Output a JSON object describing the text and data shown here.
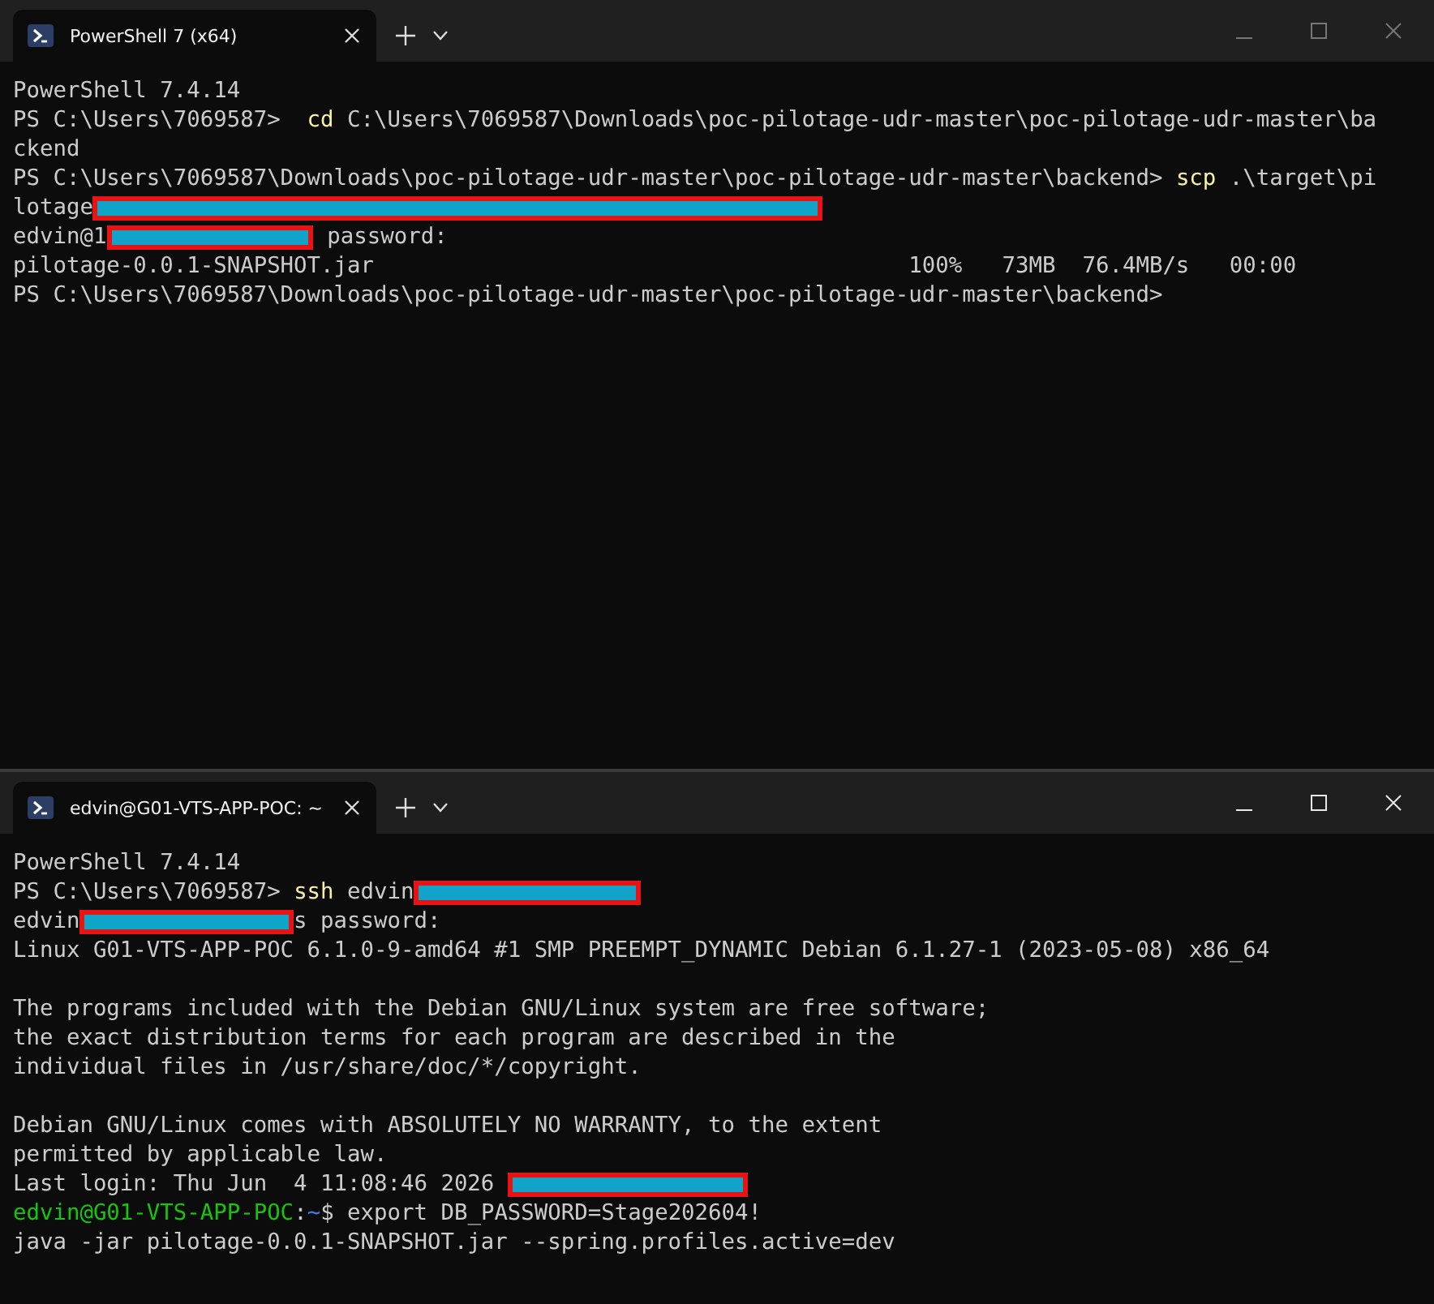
{
  "windows": [
    {
      "active": false,
      "tab": {
        "title": "PowerShell 7 (x64)"
      },
      "lines": [
        {
          "segments": [
            {
              "kind": "text",
              "text": "PowerShell 7.4.14"
            }
          ]
        },
        {
          "segments": [
            {
              "kind": "text",
              "text": "PS C:\\Users\\7069587>  "
            },
            {
              "kind": "command",
              "text": "cd"
            },
            {
              "kind": "text",
              "text": " C:\\Users\\7069587\\Downloads\\poc-pilotage-udr-master\\poc-pilotage-udr-master\\ba"
            }
          ]
        },
        {
          "segments": [
            {
              "kind": "text",
              "text": "ckend"
            }
          ]
        },
        {
          "segments": [
            {
              "kind": "text",
              "text": "PS C:\\Users\\7069587\\Downloads\\poc-pilotage-udr-master\\poc-pilotage-udr-master\\backend> "
            },
            {
              "kind": "command",
              "text": "scp"
            },
            {
              "kind": "text",
              "text": " .\\target\\pi"
            }
          ]
        },
        {
          "segments": [
            {
              "kind": "text",
              "text": "lotage"
            },
            {
              "kind": "redaction"
            }
          ]
        },
        {
          "segments": [
            {
              "kind": "text",
              "text": "edvin@1"
            },
            {
              "kind": "redaction"
            },
            {
              "kind": "text",
              "text": " password:"
            }
          ]
        },
        {
          "segments": [
            {
              "kind": "text",
              "text": "pilotage-0.0.1-SNAPSHOT.jar                                        100%   73MB  76.4MB/s   00:00"
            }
          ]
        },
        {
          "segments": [
            {
              "kind": "text",
              "text": "PS C:\\Users\\7069587\\Downloads\\poc-pilotage-udr-master\\poc-pilotage-udr-master\\backend>"
            }
          ]
        }
      ]
    },
    {
      "active": true,
      "tab": {
        "title": "edvin@G01-VTS-APP-POC: ~"
      },
      "lines": [
        {
          "segments": [
            {
              "kind": "text",
              "text": "PowerShell 7.4.14"
            }
          ]
        },
        {
          "segments": [
            {
              "kind": "text",
              "text": "PS C:\\Users\\7069587> "
            },
            {
              "kind": "command",
              "text": "ssh"
            },
            {
              "kind": "text",
              "text": " edvin"
            },
            {
              "kind": "redaction"
            }
          ]
        },
        {
          "segments": [
            {
              "kind": "text",
              "text": "edvin"
            },
            {
              "kind": "redaction"
            },
            {
              "kind": "text",
              "text": "s password:"
            }
          ]
        },
        {
          "segments": [
            {
              "kind": "text",
              "text": "Linux G01-VTS-APP-POC 6.1.0-9-amd64 #1 SMP PREEMPT_DYNAMIC Debian 6.1.27-1 (2023-05-08) x86_64"
            }
          ]
        },
        {
          "kind": "blank"
        },
        {
          "segments": [
            {
              "kind": "text",
              "text": "The programs included with the Debian GNU/Linux system are free software;"
            }
          ]
        },
        {
          "segments": [
            {
              "kind": "text",
              "text": "the exact distribution terms for each program are described in the"
            }
          ]
        },
        {
          "segments": [
            {
              "kind": "text",
              "text": "individual files in /usr/share/doc/*/copyright."
            }
          ]
        },
        {
          "kind": "blank"
        },
        {
          "segments": [
            {
              "kind": "text",
              "text": "Debian GNU/Linux comes with ABSOLUTELY NO WARRANTY, to the extent"
            }
          ]
        },
        {
          "segments": [
            {
              "kind": "text",
              "text": "permitted by applicable law."
            }
          ]
        },
        {
          "segments": [
            {
              "kind": "text",
              "text": "Last login: Thu Jun  4 11:08:46 2026 "
            },
            {
              "kind": "redaction"
            }
          ]
        },
        {
          "segments": [
            {
              "kind": "user-host",
              "text": "edvin@G01-VTS-APP-POC"
            },
            {
              "kind": "text",
              "text": ":"
            },
            {
              "kind": "path",
              "text": "~"
            },
            {
              "kind": "text",
              "text": "$ export DB_PASSWORD=Stage202604!"
            }
          ]
        },
        {
          "segments": [
            {
              "kind": "text",
              "text": "java -jar pilotage-0.0.1-SNAPSHOT.jar --spring.profiles.active=dev"
            }
          ]
        }
      ]
    }
  ]
}
